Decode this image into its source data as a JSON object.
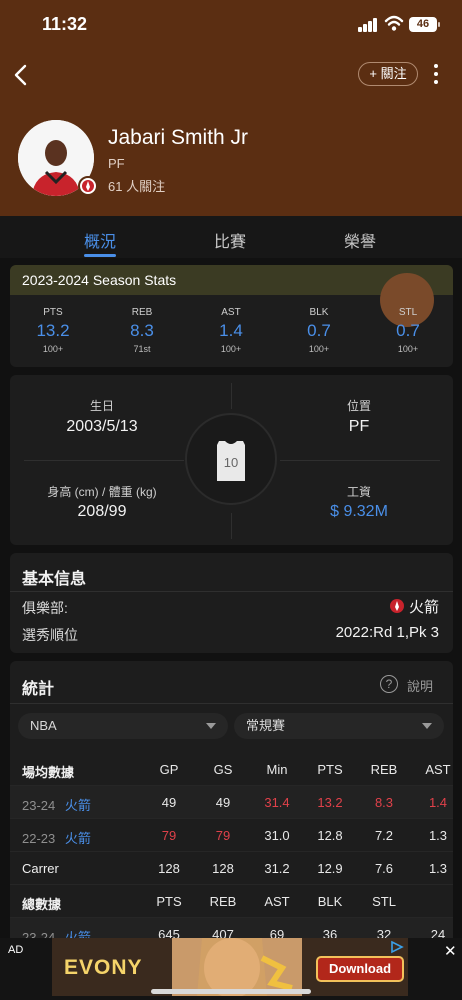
{
  "status_bar": {
    "time": "11:32",
    "battery": "46"
  },
  "header": {
    "follow_button": "+ 關注",
    "player": {
      "name": "Jabari Smith Jr",
      "position": "PF",
      "followers": "61 人關注"
    }
  },
  "tabs": [
    {
      "label": "概況",
      "active": true
    },
    {
      "label": "比賽",
      "active": false
    },
    {
      "label": "榮譽",
      "active": false
    }
  ],
  "season_stats": {
    "title": "2023-2024 Season Stats",
    "items": [
      {
        "label": "PTS",
        "value": "13.2",
        "rank": "100+"
      },
      {
        "label": "REB",
        "value": "8.3",
        "rank": "71st"
      },
      {
        "label": "AST",
        "value": "1.4",
        "rank": "100+"
      },
      {
        "label": "BLK",
        "value": "0.7",
        "rank": "100+"
      },
      {
        "label": "STL",
        "value": "0.7",
        "rank": "100+"
      }
    ]
  },
  "bio": {
    "birth_label": "生日",
    "birth_value": "2003/5/13",
    "position_label": "位置",
    "position_value": "PF",
    "size_label": "身高 (cm) / 體重 (kg)",
    "size_value": "208/99",
    "salary_label": "工資",
    "salary_value": "$ 9.32M",
    "jersey_number": "10"
  },
  "basic_info": {
    "title": "基本信息",
    "club_label": "俱樂部:",
    "club_value": "火箭",
    "draft_label": "選秀順位",
    "draft_value": "2022:Rd 1,Pk 3"
  },
  "stats": {
    "title": "統計",
    "help_label": "說明",
    "league_select": "NBA",
    "season_type_select": "常規賽",
    "avg_table": {
      "header": [
        "場均數據",
        "GP",
        "GS",
        "Min",
        "PTS",
        "REB",
        "AST"
      ],
      "rows": [
        {
          "season": "23-24",
          "team": "火箭",
          "cells": [
            "49",
            "49",
            "31.4",
            "13.2",
            "8.3",
            "1.4"
          ]
        },
        {
          "season": "22-23",
          "team": "火箭",
          "cells": [
            "79",
            "79",
            "31.0",
            "12.8",
            "7.2",
            "1.3"
          ]
        },
        {
          "season": "Carrer",
          "team": "",
          "cells": [
            "128",
            "128",
            "31.2",
            "12.9",
            "7.6",
            "1.3"
          ]
        }
      ]
    },
    "total_table": {
      "header": [
        "總數據",
        "PTS",
        "REB",
        "AST",
        "BLK",
        "STL"
      ],
      "partial_row": {
        "season": "23-24",
        "team": "火箭",
        "cells": [
          "645",
          "407",
          "69",
          "36",
          "32",
          "24"
        ]
      }
    }
  },
  "ad": {
    "label": "AD",
    "close": "✕",
    "brand": "EVONY",
    "cta": "Download"
  },
  "colors": {
    "accent": "#4a8fe8",
    "highlight": "#e0414a",
    "hero_bg": "#5b2e12"
  }
}
